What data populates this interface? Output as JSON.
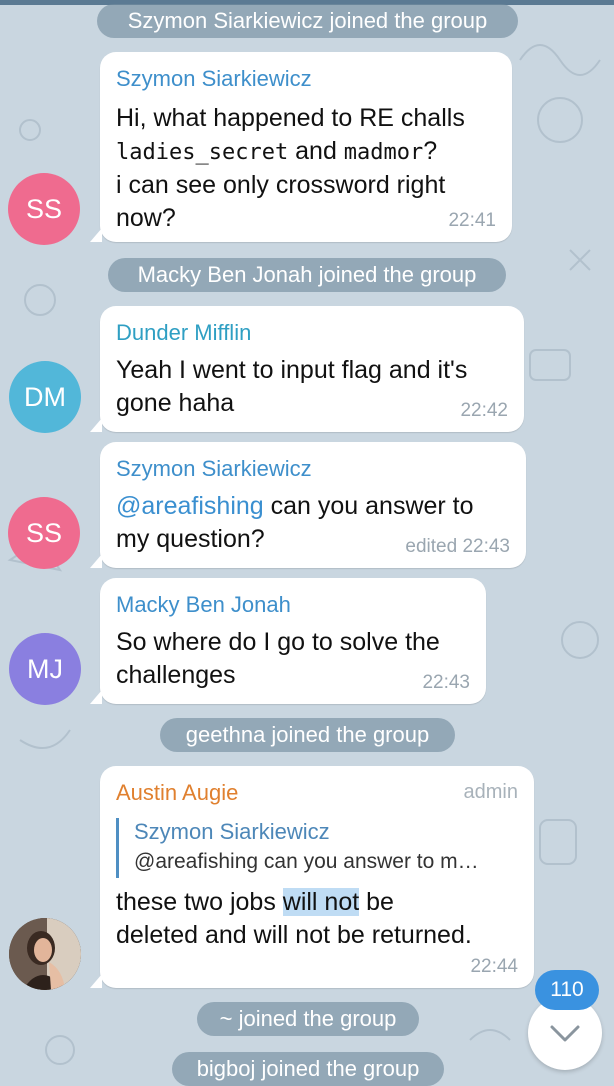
{
  "services": {
    "joined1": "Szymon Siarkiewicz joined the group",
    "joined2": "Macky Ben Jonah joined the group",
    "joined3": "geethna joined the group",
    "joined4": "~ joined the group",
    "joined5": "bigboj joined the group"
  },
  "messages": [
    {
      "avatar_initials": "SS",
      "avatar_color": "#ef6b8f",
      "sender": "Szymon Siarkiewicz",
      "sender_color": "#3e8fcb",
      "text_a": "Hi, what happened to RE challs",
      "code1": "ladies_secret",
      "text_b": " and ",
      "code2": "madmor",
      "text_c": "?",
      "text_d": "i can see only crossword right",
      "text_e": "now?",
      "time": "22:41"
    },
    {
      "avatar_initials": "DM",
      "avatar_color": "#52b7d9",
      "sender": "Dunder Mifflin",
      "sender_color": "#2f9fc3",
      "text_a": "Yeah I went to input flag and it's",
      "text_b": "gone haha",
      "time": "22:42"
    },
    {
      "avatar_initials": "SS",
      "avatar_color": "#ef6b8f",
      "sender": "Szymon Siarkiewicz",
      "sender_color": "#3e8fcb",
      "mention": "@areafishing",
      "text_a": " can you answer to",
      "text_b": "my question?",
      "time": "edited 22:43"
    },
    {
      "avatar_initials": "MJ",
      "avatar_color": "#8a7fe0",
      "sender": "Macky Ben Jonah",
      "sender_color": "#3e8fcb",
      "text_a": "So where do I go to solve the",
      "text_b": "challenges",
      "time": "22:43"
    },
    {
      "sender": "Austin Augie",
      "sender_color": "#e0802f",
      "badge": "admin",
      "reply_sender": "Szymon Siarkiewicz",
      "reply_text": "@areafishing can you answer to m…",
      "text_a": "these two jobs ",
      "highlight": "will not",
      "text_b": " be",
      "text_c": "deleted and will not be returned.",
      "time": "22:44"
    }
  ],
  "unread_count": "110",
  "icons": {
    "scroll": "chevron-down-icon"
  }
}
